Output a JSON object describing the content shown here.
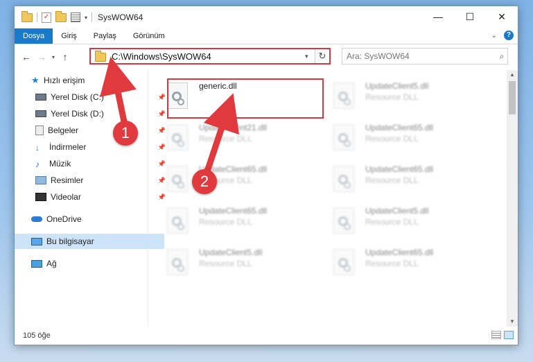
{
  "window": {
    "title": "SysWOW64",
    "controls": {
      "minimize": "—",
      "maximize": "☐",
      "close": "✕"
    }
  },
  "ribbon": {
    "tabs": [
      "Dosya",
      "Giriş",
      "Paylaş",
      "Görünüm"
    ],
    "active_tab": "Dosya",
    "help": "?"
  },
  "address": {
    "path": "C:\\Windows\\SysWOW64",
    "search_placeholder": "Ara: SysWOW64"
  },
  "nav": {
    "quick_access": "Hızlı erişim",
    "items": [
      {
        "label": "Yerel Disk (C:)",
        "icon": "drive-icon",
        "pinned": true
      },
      {
        "label": "Yerel Disk (D:)",
        "icon": "drive-icon",
        "pinned": true
      },
      {
        "label": "Belgeler",
        "icon": "documents-icon",
        "pinned": true
      },
      {
        "label": "İndirmeler",
        "icon": "downloads-icon",
        "pinned": true
      },
      {
        "label": "Müzik",
        "icon": "music-icon",
        "pinned": true
      },
      {
        "label": "Resimler",
        "icon": "pictures-icon",
        "pinned": true
      },
      {
        "label": "Videolar",
        "icon": "videos-icon",
        "pinned": true
      }
    ],
    "onedrive": "OneDrive",
    "this_pc": "Bu bilgisayar",
    "network": "Ağ"
  },
  "files": [
    {
      "name": "generic.dll",
      "type": "",
      "blurred": false
    },
    {
      "name": "UpdateClient5.dll",
      "type": "Resource DLL",
      "blurred": true
    },
    {
      "name": "UpdateClient21.dll",
      "type": "Resource DLL",
      "blurred": true
    },
    {
      "name": "UpdateClient65.dll",
      "type": "Resource DLL",
      "blurred": true
    },
    {
      "name": "UpdateClient65.dll",
      "type": "Resource DLL",
      "blurred": true
    },
    {
      "name": "UpdateClient65.dll",
      "type": "Resource DLL",
      "blurred": true
    },
    {
      "name": "UpdateClient65.dll",
      "type": "Resource DLL",
      "blurred": true
    },
    {
      "name": "UpdateClient5.dll",
      "type": "Resource DLL",
      "blurred": true
    },
    {
      "name": "UpdateClient5.dll",
      "type": "Resource DLL",
      "blurred": true
    },
    {
      "name": "UpdateClient65.dll",
      "type": "Resource DLL",
      "blurred": true
    }
  ],
  "status": {
    "count": "105 öğe"
  },
  "annotations": {
    "step1": "1",
    "step2": "2",
    "color": "#e03a3e"
  }
}
